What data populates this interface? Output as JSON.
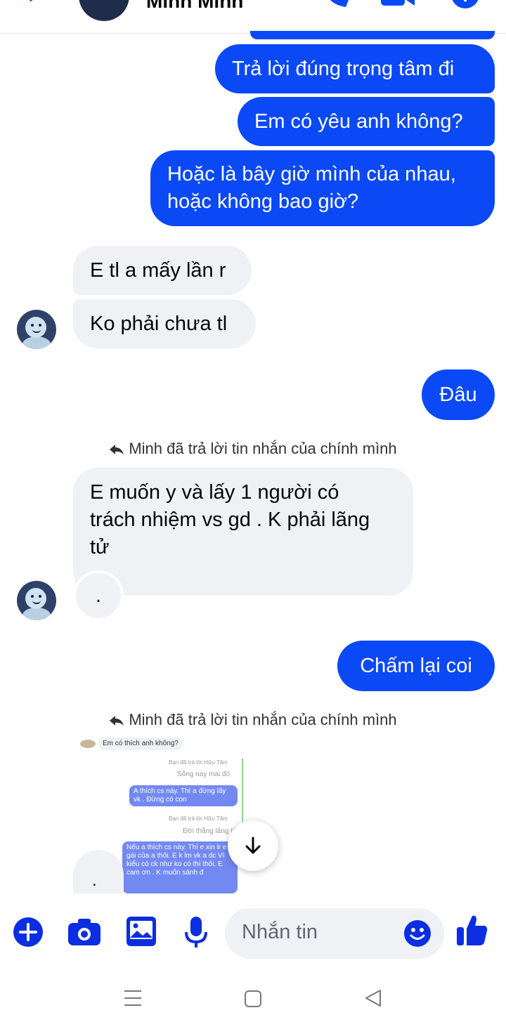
{
  "header": {
    "contact_name": "Minh Minh"
  },
  "messages": {
    "m1": "Trả lời đúng trọng tâm đi",
    "m2": "Em có yêu anh không?",
    "m3_line1": "Hoặc là bây giờ mình của nhau,",
    "m3_line2": "hoặc không bao giờ?",
    "m4": "E tl a mấy lần r",
    "m5": "Ko phải chưa tl",
    "m6": "Đâu",
    "reply1": "Minh đã trả lời tin nhắn của chính mình",
    "m7_line1": "E muốn y và lấy 1 người có",
    "m7_line2": "trách nhiệm vs gd . K phải lãng",
    "m7_line3": "tử",
    "m8": ".",
    "m9": "Chấm lại coi",
    "reply2": "Minh đã trả lời tin nhắn của chính mình",
    "m10": "."
  },
  "thumbnail": {
    "q": "Em có thích anh không?",
    "note1": "Bạn đã trả lời Hữu Tâm",
    "line1": "Sống nay mai đó",
    "out1": "A thích cs này. Thì a đừng lấy vk . Đừng có con",
    "note2": "Bạn đã trả lời Hữu Tâm",
    "line2": "Đời thằng lãng tử",
    "out2": "Nếu a thích cs này. Thì e xin lr e gái của a thôi. E k lm vk a dc Vì kiểu có ck như ko có thì thôi. E cam ơn . K muốn sánh đ"
  },
  "composer": {
    "placeholder": "Nhắn tin"
  },
  "colors": {
    "brand": "#0a49f5",
    "incoming": "#f0f1f5",
    "icon": "#0a2ee0"
  },
  "icons": [
    "back-icon",
    "call-icon",
    "video-icon",
    "info-icon",
    "reply-arrow-icon",
    "arrow-down-icon",
    "plus-icon",
    "camera-icon",
    "gallery-icon",
    "mic-icon",
    "emoji-icon",
    "like-icon",
    "recents-icon",
    "home-icon",
    "nav-back-icon"
  ]
}
